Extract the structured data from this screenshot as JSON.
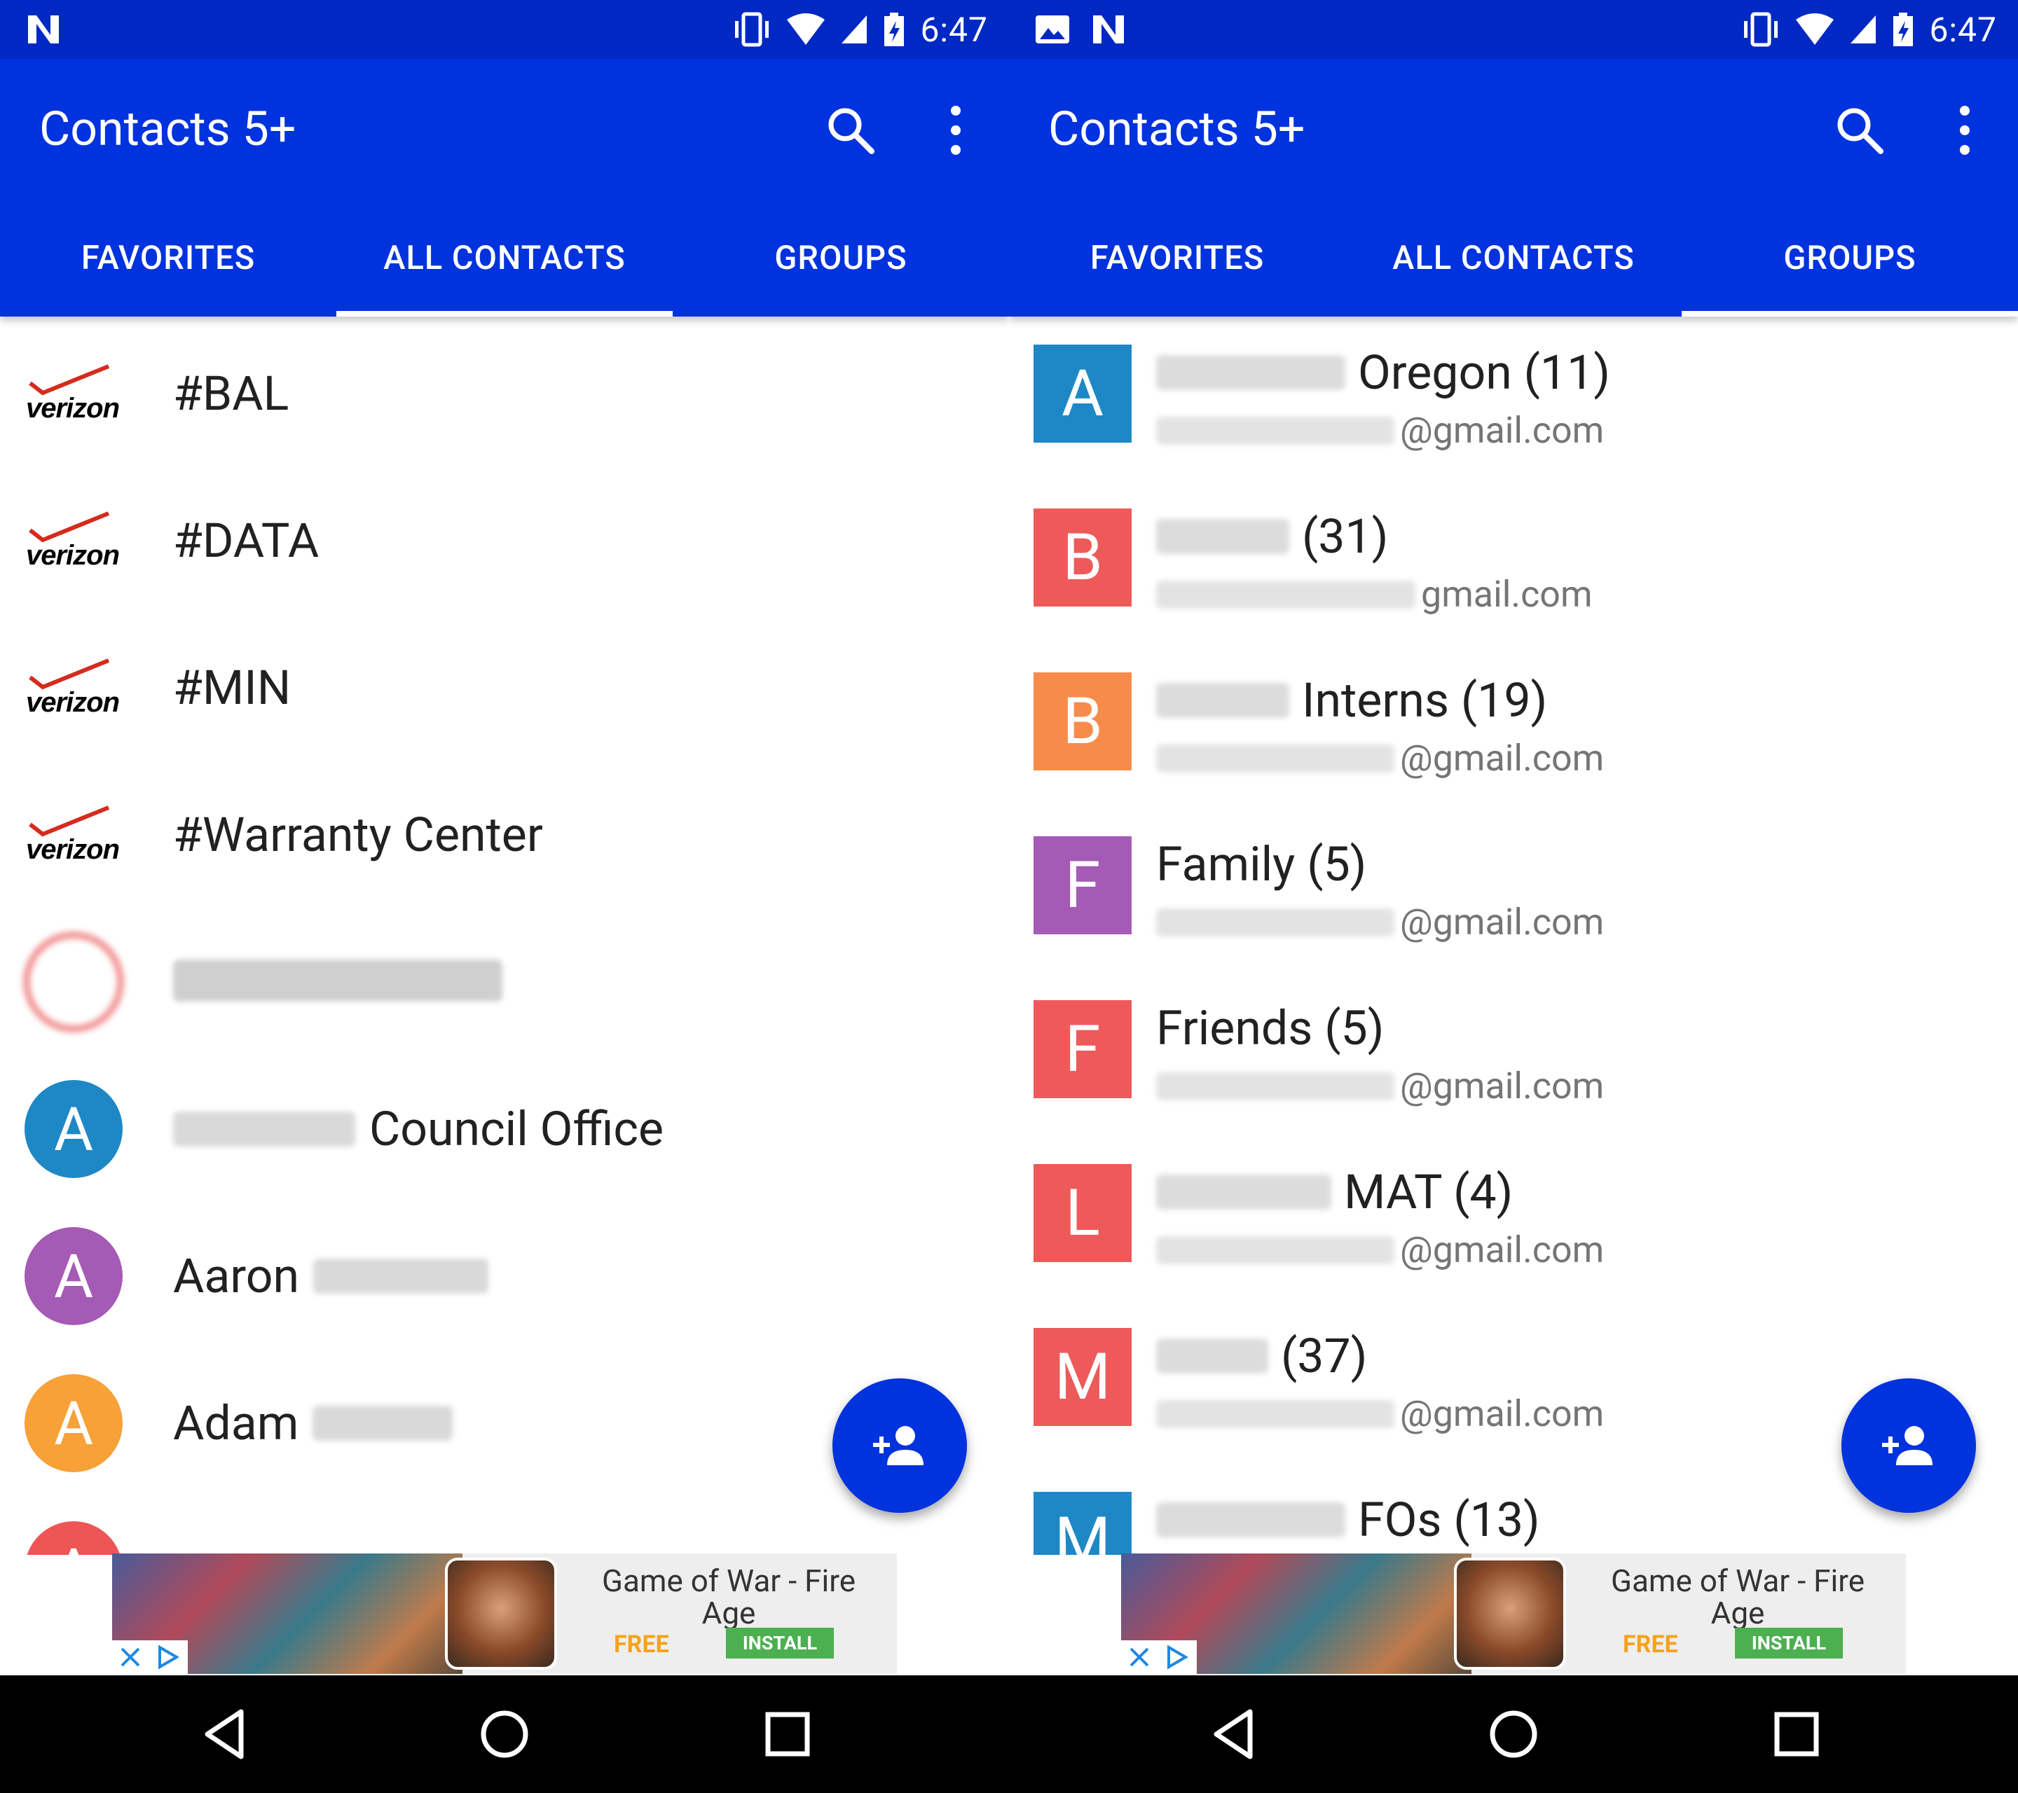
{
  "screens": [
    {
      "status_bar": {
        "time": "6:47"
      },
      "toolbar": {
        "title": "Contacts 5+"
      },
      "tabs": [
        {
          "label": "FAVORITES"
        },
        {
          "label": "ALL CONTACTS",
          "selected": true
        },
        {
          "label": "GROUPS"
        }
      ],
      "contacts": [
        {
          "name": "#BAL",
          "avatar": "verizon"
        },
        {
          "name": "#DATA",
          "avatar": "verizon"
        },
        {
          "name": "#MIN",
          "avatar": "verizon"
        },
        {
          "name": "#Warranty Center",
          "avatar": "verizon"
        },
        {
          "name": "",
          "avatar": "blurred"
        },
        {
          "name": "Council Office",
          "avatar": "letter",
          "initial": "A",
          "color": "#1e88c7"
        },
        {
          "name": "Aaron",
          "avatar": "letter",
          "initial": "A",
          "color": "#a55ab5"
        },
        {
          "name": "Adam",
          "avatar": "letter",
          "initial": "A",
          "color": "#f7a138"
        },
        {
          "name": "",
          "avatar": "letter",
          "initial": "A",
          "color": "#ee5555"
        }
      ]
    },
    {
      "status_bar": {
        "time": "6:47"
      },
      "toolbar": {
        "title": "Contacts 5+"
      },
      "tabs": [
        {
          "label": "FAVORITES"
        },
        {
          "label": "ALL CONTACTS"
        },
        {
          "label": "GROUPS",
          "selected": true
        }
      ],
      "groups": [
        {
          "name": "Oregon (11)",
          "email": "@gmail.com",
          "initial": "A",
          "color": "#1e88c7"
        },
        {
          "name": "(31)",
          "email": "gmail.com",
          "initial": "B",
          "color": "#ee5a5a"
        },
        {
          "name": "Interns (19)",
          "email": "@gmail.com",
          "initial": "B",
          "color": "#f78c4a"
        },
        {
          "name": "Family (5)",
          "email": "@gmail.com",
          "initial": "F",
          "color": "#a55ab5"
        },
        {
          "name": "Friends (5)",
          "email": "@gmail.com",
          "initial": "F",
          "color": "#ee5a5a"
        },
        {
          "name": "MAT (4)",
          "email": "@gmail.com",
          "initial": "L",
          "color": "#ee5a5a"
        },
        {
          "name": "(37)",
          "email": "@gmail.com",
          "initial": "M",
          "color": "#ee5a5a"
        },
        {
          "name": "FOs (13)",
          "email": "",
          "initial": "M",
          "color": "#1e88c7"
        }
      ]
    }
  ],
  "ad": {
    "title": "Game of War - Fire Age",
    "price": "FREE",
    "cta": "INSTALL"
  },
  "colors": {
    "status_bar": "#0029c3",
    "app_bar": "#0033dd",
    "fab": "#0033dd",
    "nav_bar": "#000000",
    "install_button": "#4caf50",
    "free_text": "#f7a21b"
  },
  "icons": {
    "status": [
      "notification-n-icon",
      "vibrate-icon",
      "wifi-icon",
      "signal-icon",
      "battery-icon"
    ],
    "toolbar": [
      "search-icon",
      "more-vert-icon"
    ],
    "fab": "add-contact-icon",
    "nav": [
      "back-icon",
      "home-icon",
      "recents-icon"
    ]
  }
}
